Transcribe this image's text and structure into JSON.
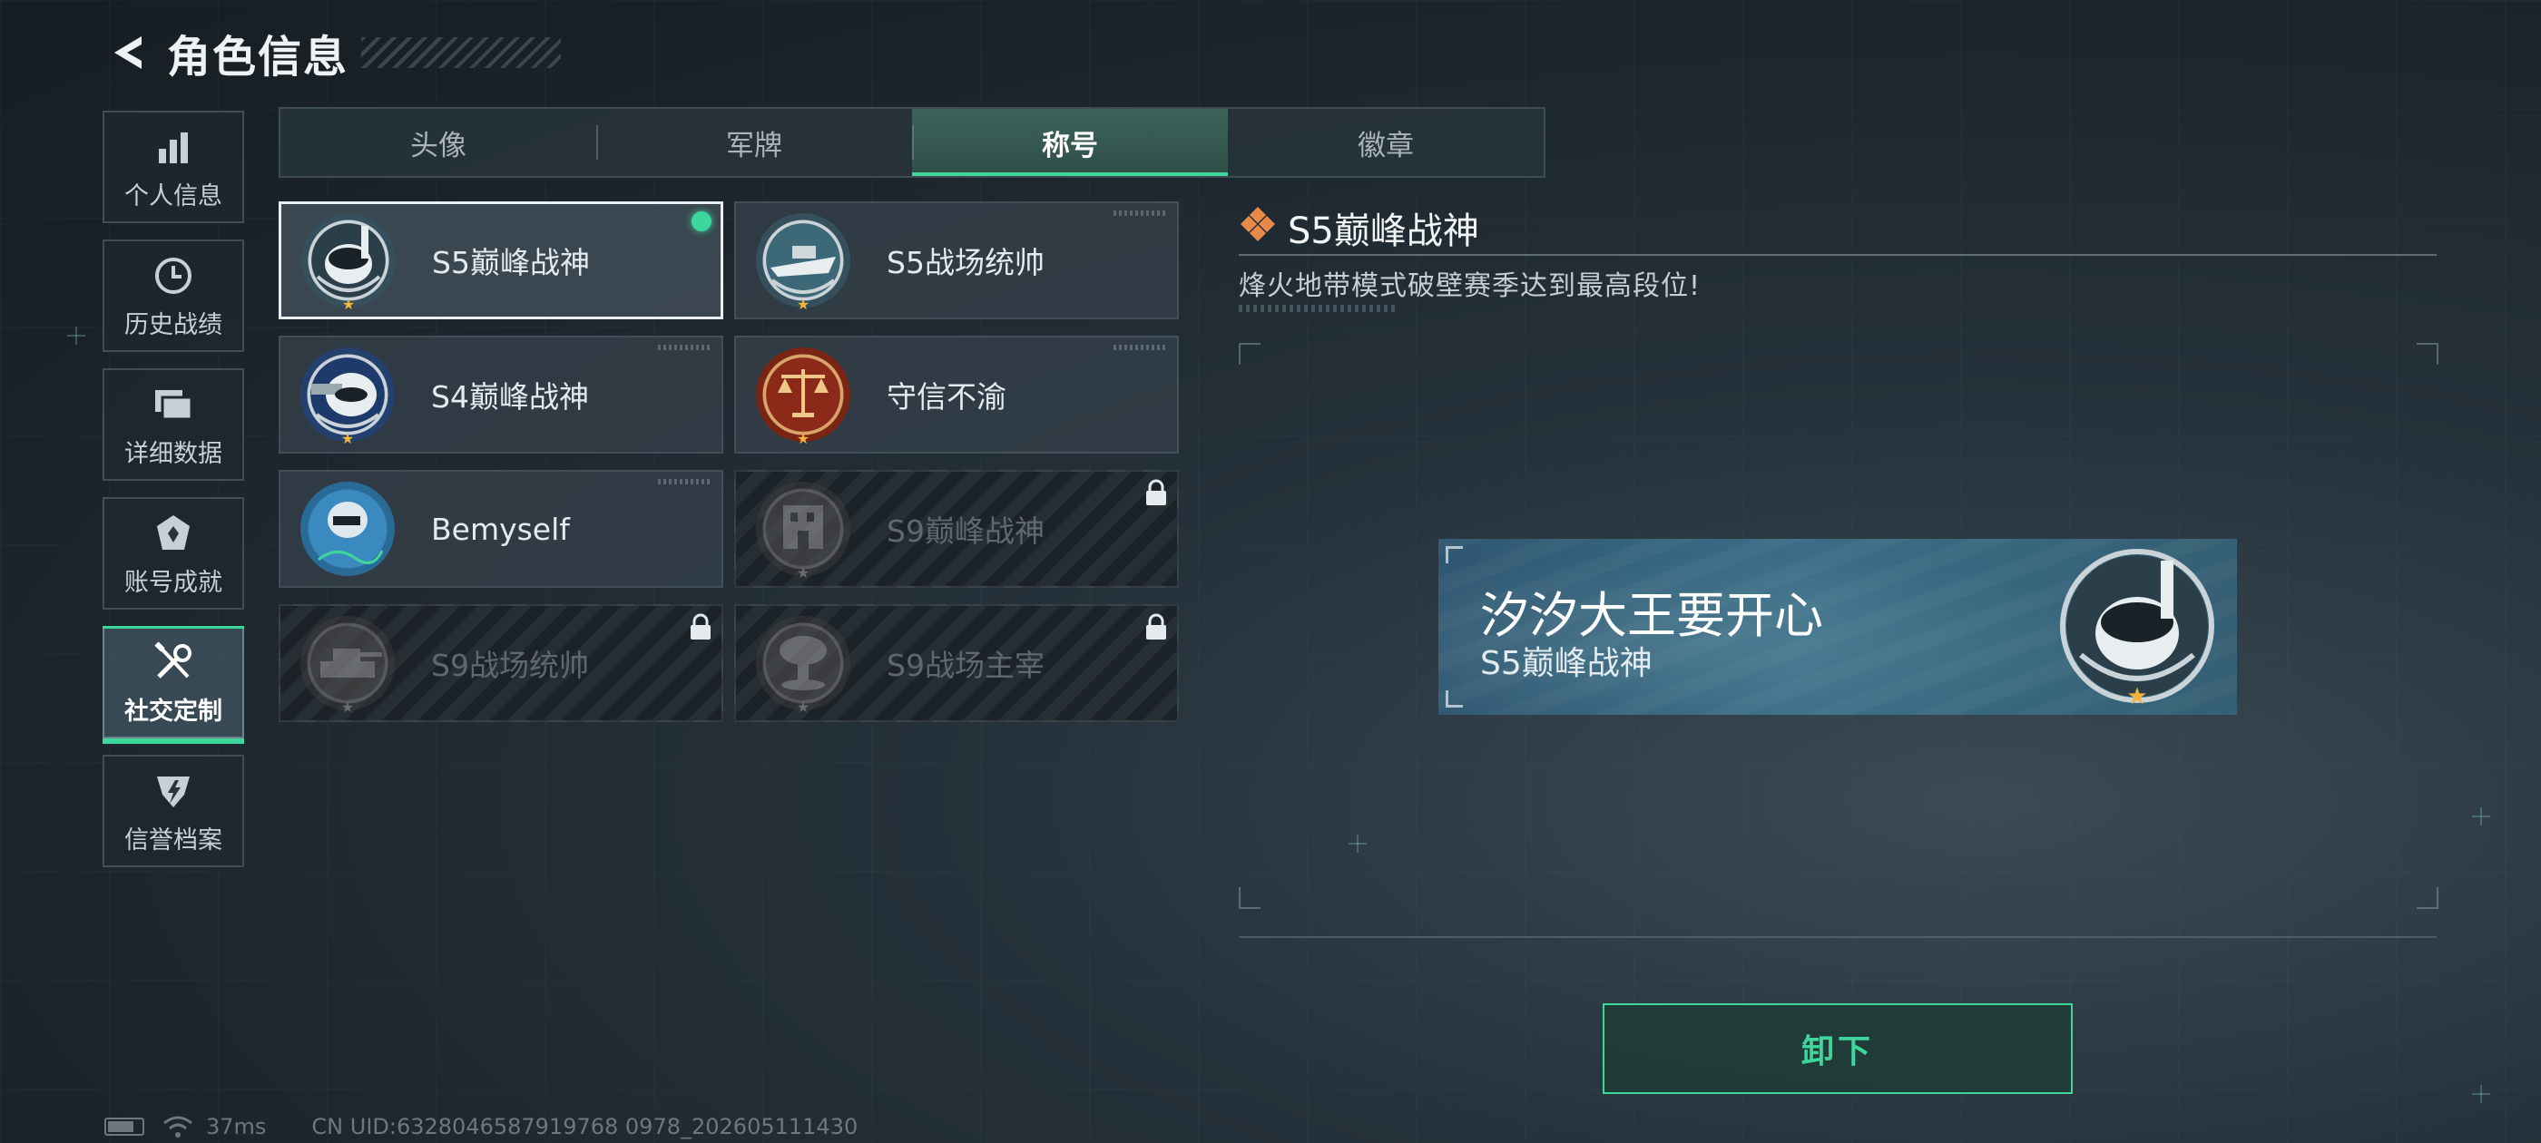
{
  "header": {
    "title": "角色信息"
  },
  "nav": {
    "items": [
      {
        "label": "个人信息",
        "icon": "bar-chart-icon"
      },
      {
        "label": "历史战绩",
        "icon": "clock-icon"
      },
      {
        "label": "详细数据",
        "icon": "folder-icon"
      },
      {
        "label": "账号成就",
        "icon": "achievement-icon"
      },
      {
        "label": "社交定制",
        "icon": "tools-icon",
        "active": true
      },
      {
        "label": "信誉档案",
        "icon": "shield-icon"
      }
    ]
  },
  "tabs": [
    {
      "label": "头像"
    },
    {
      "label": "军牌"
    },
    {
      "label": "称号",
      "active": true
    },
    {
      "label": "徽章"
    }
  ],
  "titles": [
    {
      "label": "S5巅峰战神",
      "medal": "diver-skull-medal-icon",
      "selected": true,
      "equipped": true
    },
    {
      "label": "S5战场统帅",
      "medal": "boat-medal-icon"
    },
    {
      "label": "S4巅峰战神",
      "medal": "helmet-skull-medal-icon"
    },
    {
      "label": "守信不渝",
      "medal": "scales-medal-icon"
    },
    {
      "label": "Bemyself",
      "medal": "soldier-medal-icon"
    },
    {
      "label": "S9巅峰战神",
      "medal": "building-medal-icon",
      "locked": true
    },
    {
      "label": "S9战场统帅",
      "medal": "tank-medal-icon",
      "locked": true
    },
    {
      "label": "S9战场主宰",
      "medal": "mushroom-cloud-medal-icon",
      "locked": true
    }
  ],
  "detail": {
    "title": "S5巅峰战神",
    "description": "烽火地带模式破壁赛季达到最高段位!"
  },
  "preview": {
    "player_name": "汐汐大王要开心",
    "title": "S5巅峰战神"
  },
  "actions": {
    "unequip_label": "卸下"
  },
  "status": {
    "ping": "37ms",
    "uid": "CN UID:6328046587919768 0978_202605111430"
  },
  "colors": {
    "accent": "#3ed69a",
    "locked_text": "#5e686f",
    "diamond": "#e8894a"
  }
}
